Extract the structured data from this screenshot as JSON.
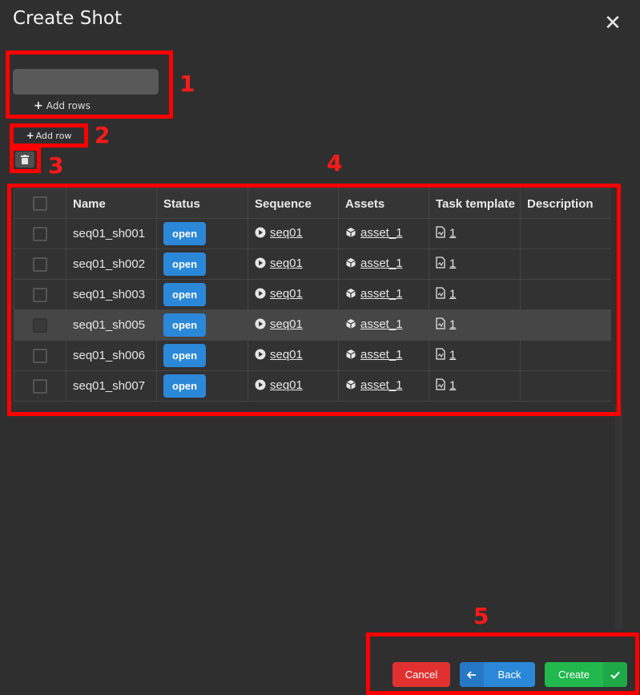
{
  "dialog": {
    "title": "Create Shot"
  },
  "input": {
    "value": "",
    "placeholder": ""
  },
  "actions": {
    "add_rows_label": "Add rows",
    "add_row_label": "Add row"
  },
  "annotations": [
    "1",
    "2",
    "3",
    "4",
    "5"
  ],
  "table": {
    "headers": [
      "Name",
      "Status",
      "Sequence",
      "Assets",
      "Task template",
      "Description"
    ],
    "rows": [
      {
        "name": "seq01_sh001",
        "status": "open",
        "sequence": "seq01",
        "asset": "asset_1",
        "task_template": "1",
        "description": "",
        "selected": false
      },
      {
        "name": "seq01_sh002",
        "status": "open",
        "sequence": "seq01",
        "asset": "asset_1",
        "task_template": "1",
        "description": "",
        "selected": false
      },
      {
        "name": "seq01_sh003",
        "status": "open",
        "sequence": "seq01",
        "asset": "asset_1",
        "task_template": "1",
        "description": "",
        "selected": false
      },
      {
        "name": "seq01_sh005",
        "status": "open",
        "sequence": "seq01",
        "asset": "asset_1",
        "task_template": "1",
        "description": "",
        "selected": true
      },
      {
        "name": "seq01_sh006",
        "status": "open",
        "sequence": "seq01",
        "asset": "asset_1",
        "task_template": "1",
        "description": "",
        "selected": false
      },
      {
        "name": "seq01_sh007",
        "status": "open",
        "sequence": "seq01",
        "asset": "asset_1",
        "task_template": "1",
        "description": "",
        "selected": false
      }
    ]
  },
  "footer": {
    "cancel_label": "Cancel",
    "back_label": "Back",
    "create_label": "Create"
  },
  "colors": {
    "annotation": "#ff0000",
    "status_open": "#2b88d8",
    "cancel": "#e03030",
    "back": "#2b88d8",
    "create": "#21b84d"
  }
}
